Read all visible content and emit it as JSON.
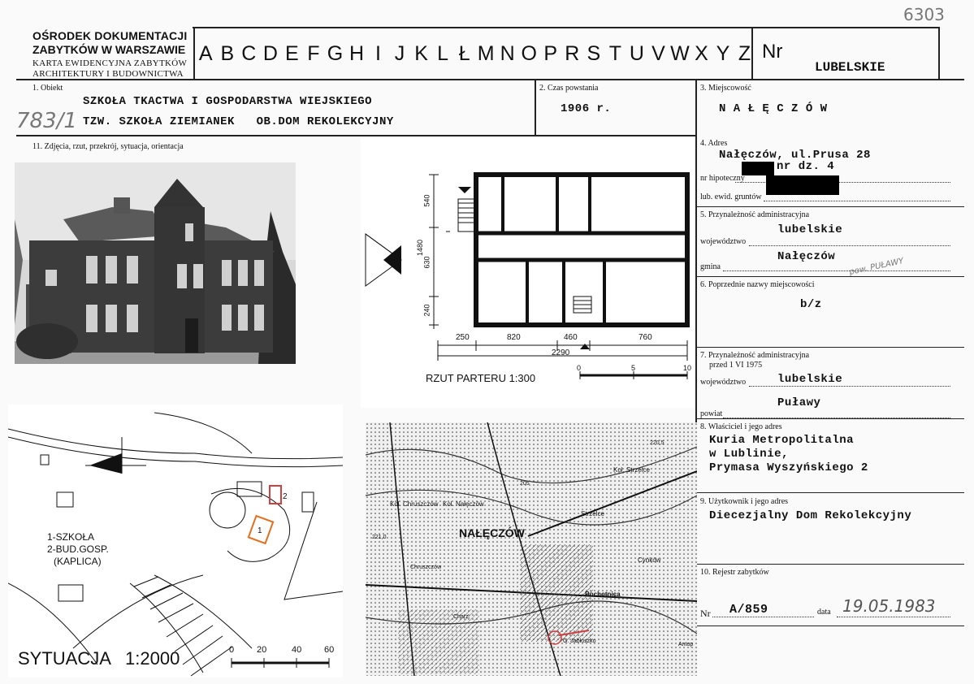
{
  "corner_number": "6303",
  "header": {
    "org_line1": "OŚRODEK DOKUMENTACJI",
    "org_line2": "ZABYTKÓW W WARSZAWIE",
    "card_line1": "KARTA EWIDENCYJNA ZABYTKÓW",
    "card_line2": "ARCHITEKTURY I BUDOWNICTWA",
    "letters": [
      "A",
      "B",
      "C",
      "D",
      "E",
      "F",
      "G",
      "H",
      "I",
      "J",
      "K",
      "L",
      "Ł",
      "M",
      "N",
      "O",
      "P",
      "R",
      "S",
      "T",
      "U",
      "V",
      "W",
      "X",
      "Y",
      "Z"
    ],
    "nr_label": "Nr",
    "region": "LUBELSKIE"
  },
  "obiekt": {
    "label": "1. Obiekt",
    "line1": "SZKOŁA TKACTWA I GOSPODARSTWA WIEJSKIEGO",
    "line2": "TZW. SZKOŁA ZIEMIANEK   OB.DOM REKOLEKCYJNY",
    "handwritten": "783/1"
  },
  "czas": {
    "label": "2. Czas powstania",
    "value": "1906 r."
  },
  "miejscowosc": {
    "label": "3. Miejscowość",
    "value": "N A Ł Ę C Z Ó W"
  },
  "zdjecia_label": "11. Zdjęcia, rzut, przekrój, sytuacja, orientacja",
  "adres": {
    "label": "4. Adres",
    "street": "Nałęczów, ul.Prusa 28",
    "nr_dz": "nr dz. 4",
    "hipoteczny_label": "nr hipoteczny",
    "grunt_label": "lub. ewid. gruntów"
  },
  "przynaleznosc": {
    "label": "5. Przynależność administracyjna",
    "woj_label": "województwo",
    "woj_value": "lubelskie",
    "gmina_label": "gmina",
    "gmina_value": "Nałęczów",
    "gmina_hand": "pow. PUŁAWY"
  },
  "poprzednie": {
    "label": "6. Poprzednie nazwy miejscowości",
    "value": "b/z"
  },
  "przynaleznosc_przed": {
    "label1": "7. Przynależność administracyjna",
    "label2": "przed 1 VI 1975",
    "woj_label": "województwo",
    "woj_value": "lubelskie",
    "powiat_label": "powiat",
    "powiat_value": "Puławy"
  },
  "wlasciciel": {
    "label": "8. Właściciel i jego adres",
    "line1": "Kuria Metropolitalna",
    "line2": "w Lublinie,",
    "line3": "Prymasa Wyszyńskiego 2"
  },
  "uzytkownik": {
    "label": "9. Użytkownik i jego adres",
    "value": "Diecezjalny Dom Rekolekcyjny"
  },
  "rejestr": {
    "label": "10. Rejestr zabytków",
    "nr_label": "Nr",
    "nr_value": "A/859",
    "data_label": "data",
    "data_value": "19.05.1983"
  },
  "floorplan": {
    "caption": "RZUT PARTERU 1:300",
    "dims_bottom": [
      "250",
      "820",
      "460",
      "760"
    ],
    "dim_total": "2290",
    "dims_left": [
      "540",
      "630",
      "240"
    ],
    "dim_left_total": "1480",
    "scale_ticks": [
      "0",
      "5",
      "10"
    ]
  },
  "situation": {
    "legend1": "1-SZKOŁA",
    "legend2": "2-BUD.GOSP.",
    "legend3": "(KAPLICA)",
    "caption": "SYTUACJA   1:2000",
    "scale_ticks": [
      "0",
      "20",
      "40",
      "60"
    ],
    "markers": [
      "1",
      "2"
    ]
  },
  "map": {
    "town": "NAŁĘCZÓW",
    "labels": [
      "Kol. Chruszczów",
      "Kol. Nałęczów",
      "Kol. Strzelce",
      "Strzelce",
      "Chruszczów",
      "Cynków",
      "Bochotnica",
      "Charz.",
      "G. Jabłuszko",
      "Antop",
      "220,5",
      "221,0",
      "205"
    ]
  },
  "colors": {
    "paper": "#fafafa",
    "ink": "#111111",
    "highlight": "#d04040",
    "school_outline": "#e07020"
  }
}
